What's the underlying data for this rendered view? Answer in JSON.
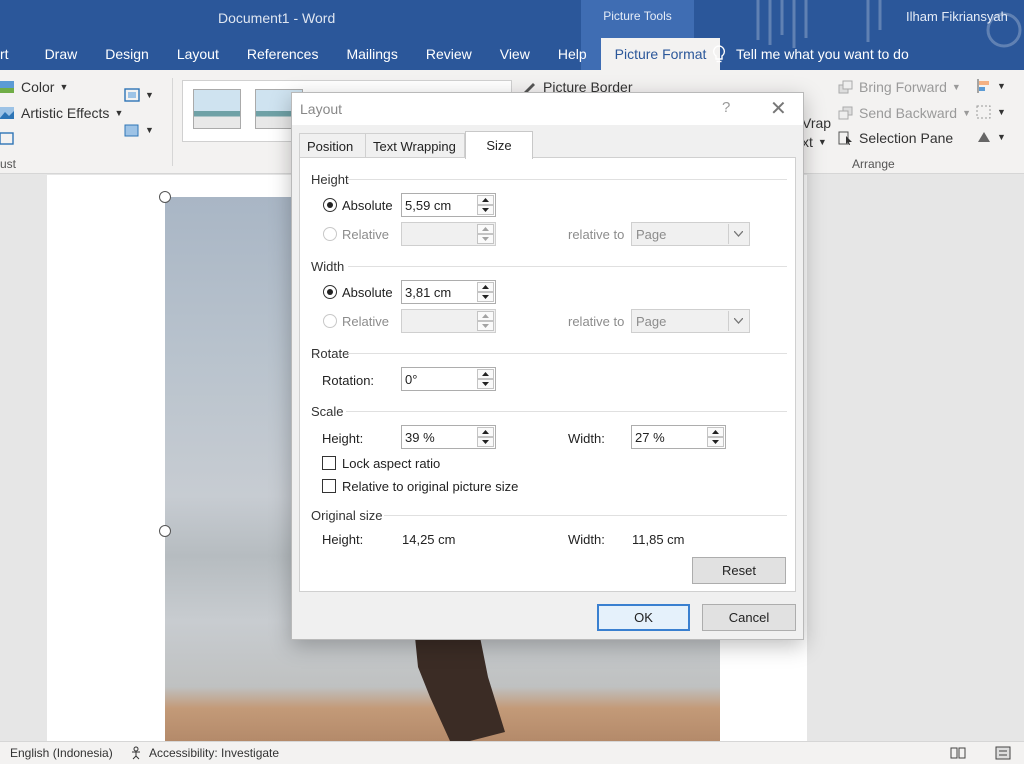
{
  "titlebar": {
    "document_title": "Document1  -  Word",
    "context_label": "Picture Tools",
    "user_name": "Ilham Fikriansyah",
    "colors": {
      "ribbon_blue": "#2b579a",
      "context_band": "#3f6db3"
    }
  },
  "ribbon_tabs": [
    "rt",
    "Draw",
    "Design",
    "Layout",
    "References",
    "Mailings",
    "Review",
    "View",
    "Help",
    "Picture Format"
  ],
  "active_tab": "Picture Format",
  "tell_me": {
    "text": "Tell me what you want to do",
    "icon": "lightbulb-icon"
  },
  "ribbon": {
    "adjust": {
      "color_label": "Color",
      "artistic_effects_label": "Artistic Effects",
      "group_label": "ust"
    },
    "picture_border_label": "Picture Border",
    "wrap_text_top": "Vrap",
    "wrap_text_bottom": "xt",
    "arrange": {
      "bring_forward": "Bring Forward",
      "send_backward": "Send Backward",
      "selection_pane": "Selection Pane",
      "group_label": "Arrange"
    }
  },
  "dialog": {
    "title": "Layout",
    "help": "?",
    "tabs": [
      "Position",
      "Text Wrapping",
      "Size"
    ],
    "active_tab": "Size",
    "height_section": {
      "title": "Height",
      "absolute_label": "Absolute",
      "absolute_value": "5,59 cm",
      "relative_label": "Relative",
      "relative_to_label": "relative to",
      "relative_to_value": "Page"
    },
    "width_section": {
      "title": "Width",
      "absolute_label": "Absolute",
      "absolute_value": "3,81 cm",
      "relative_label": "Relative",
      "relative_to_label": "relative to",
      "relative_to_value": "Page"
    },
    "rotate_section": {
      "title": "Rotate",
      "rotation_label": "Rotation:",
      "rotation_value": "0°"
    },
    "scale_section": {
      "title": "Scale",
      "height_label": "Height:",
      "height_value": "39 %",
      "width_label": "Width:",
      "width_value": "27 %",
      "lock_aspect_label": "Lock aspect ratio",
      "lock_aspect_checked": false,
      "relative_original_label": "Relative to original picture size",
      "relative_original_checked": false
    },
    "original_size_section": {
      "title": "Original size",
      "height_label": "Height:",
      "height_value": "14,25 cm",
      "width_label": "Width:",
      "width_value": "11,85 cm"
    },
    "reset_label": "Reset",
    "ok_label": "OK",
    "cancel_label": "Cancel"
  },
  "statusbar": {
    "language": "English (Indonesia)",
    "accessibility": "Accessibility: Investigate"
  }
}
